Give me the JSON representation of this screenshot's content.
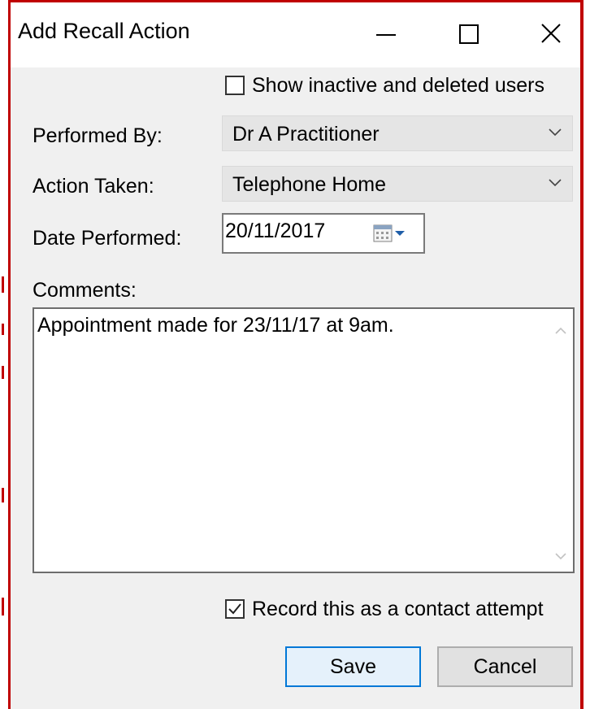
{
  "window": {
    "title": "Add Recall Action",
    "minimize_icon": "minimize-icon",
    "maximize_icon": "maximize-icon",
    "close_icon": "close-icon"
  },
  "show_inactive": {
    "label": "Show inactive and deleted users",
    "checked": false
  },
  "performed_by": {
    "label": "Performed By:",
    "value": "Dr A Practitioner"
  },
  "action_taken": {
    "label": "Action Taken:",
    "value": "Telephone Home"
  },
  "date_performed": {
    "label": "Date Performed:",
    "value": "20/11/2017",
    "icon": "calendar-icon"
  },
  "comments": {
    "label": "Comments:",
    "value": "Appointment made for 23/11/17 at 9am."
  },
  "record_contact": {
    "label": "Record this as a contact attempt",
    "checked": true
  },
  "buttons": {
    "save": "Save",
    "cancel": "Cancel"
  },
  "colors": {
    "highlight_border": "#c00000",
    "default_button_border": "#0078d7",
    "dialog_background": "#f0f0f0"
  }
}
